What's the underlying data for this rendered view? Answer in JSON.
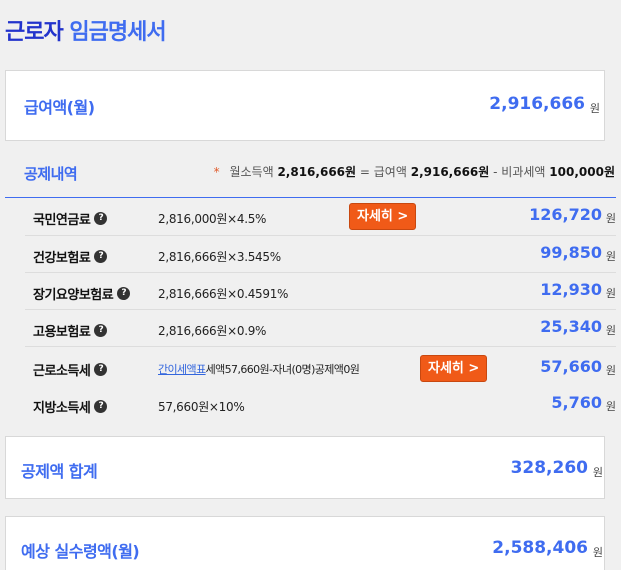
{
  "header": {
    "title_part1": "근로자",
    "title_part2": "임금명세서"
  },
  "gross": {
    "label": "급여액(월)",
    "amount": "2,916,666",
    "unit": "원"
  },
  "deductions": {
    "heading": "공제내역",
    "note": {
      "star": "*",
      "prefix": "월소득액",
      "monthly": "2,816,666원",
      "eq": "= 급여액",
      "gross": "2,916,666원",
      "minus": "- 비과세액",
      "nontax": "100,000원"
    },
    "detail_button": "자세히 >",
    "help_icon": "?",
    "items": [
      {
        "name": "국민연금료",
        "calc": "2,816,000원×4.5%",
        "amount": "126,720",
        "unit": "원"
      },
      {
        "name": "건강보험료",
        "calc": "2,816,666원×3.545%",
        "amount": "99,850",
        "unit": "원"
      },
      {
        "name": "장기요양보험료",
        "calc": "2,816,666원×0.4591%",
        "amount": "12,930",
        "unit": "원"
      },
      {
        "name": "고용보험료",
        "calc": "2,816,666원×0.9%",
        "amount": "25,340",
        "unit": "원"
      },
      {
        "name": "근로소득세",
        "calc_link": "간이세액표",
        "calc": "세액57,660원-자녀(0명)공제액0원",
        "amount": "57,660",
        "unit": "원"
      },
      {
        "name": "지방소득세",
        "calc": "57,660원×10%",
        "amount": "5,760",
        "unit": "원"
      }
    ]
  },
  "total": {
    "label": "공제액 합계",
    "amount": "328,260",
    "unit": "원"
  },
  "net": {
    "label": "예상 실수령액(월)",
    "amount": "2,588,406",
    "unit": "원"
  },
  "colors": {
    "accent": "#3f6cf0",
    "title_dark": "#2233cc",
    "button": "#f05a18",
    "star": "#e05a2a"
  }
}
